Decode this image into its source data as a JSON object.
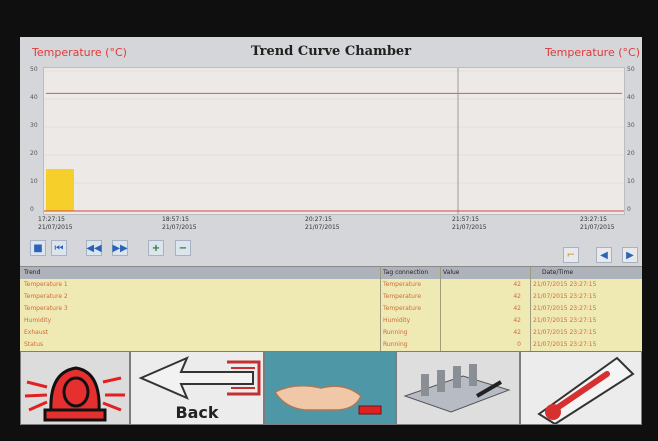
{
  "header": {
    "left_axis_label": "Temperature (°C)",
    "title": "Trend Curve Chamber",
    "right_axis_label": "Temperature (°C)"
  },
  "chart_data": {
    "type": "line",
    "title": "Trend Curve Chamber",
    "ylabel_left": "Temperature (°C)",
    "ylabel_right": "Temperature (°C)",
    "ylim": [
      0,
      50
    ],
    "yticks": [
      0,
      10,
      20,
      30,
      40,
      50
    ],
    "xticks": [
      {
        "time": "17:27:15",
        "date": "21/07/2015"
      },
      {
        "time": "18:57:15",
        "date": "21/07/2015"
      },
      {
        "time": "20:27:15",
        "date": "21/07/2015"
      },
      {
        "time": "21:57:15",
        "date": "21/07/2015"
      },
      {
        "time": "23:27:15",
        "date": "21/07/2015"
      }
    ],
    "series": [
      {
        "color": "#e25252",
        "values": [
          42,
          42,
          42,
          42,
          42
        ]
      }
    ],
    "bar_start": {
      "value": 15,
      "color": "#f6cf2b"
    },
    "cursor_x": "21:57:15"
  },
  "toolbar": {
    "buttons": [
      "stop-icon",
      "first-icon",
      "rewind-icon",
      "forward-icon",
      "zoom-in-icon",
      "zoom-out-icon"
    ],
    "right_buttons": [
      "ruler-icon",
      "scroll-left-icon",
      "scroll-right-icon"
    ]
  },
  "table": {
    "headers": [
      "Trend",
      "Tag connection",
      "Value",
      "Date/Time"
    ],
    "rows": [
      {
        "trend": "Temperature 1",
        "tag": "Temperature",
        "value": "42",
        "datetime": "21/07/2015 23:27:15"
      },
      {
        "trend": "Temperature 2",
        "tag": "Temperature",
        "value": "42",
        "datetime": "21/07/2015 23:27:15"
      },
      {
        "trend": "Temperature 3",
        "tag": "Temperature",
        "value": "42",
        "datetime": "21/07/2015 23:27:15"
      },
      {
        "trend": "Humidity",
        "tag": "Humidity",
        "value": "42",
        "datetime": "21/07/2015 23:27:15"
      },
      {
        "trend": "Exhaust",
        "tag": "Running",
        "value": "42",
        "datetime": "21/07/2015 23:27:15"
      },
      {
        "trend": "Status",
        "tag": "Running",
        "value": "0",
        "datetime": "21/07/2015 23:27:15"
      }
    ]
  },
  "bottom_bar": {
    "back_label": "Back",
    "alarm_icon": "alarm-beacon-icon",
    "back_icon": "arrow-left-icon",
    "touch_icon": "hand-touch-icon",
    "racks_icon": "racks-icon",
    "thermometer_icon": "thermometer-icon"
  }
}
